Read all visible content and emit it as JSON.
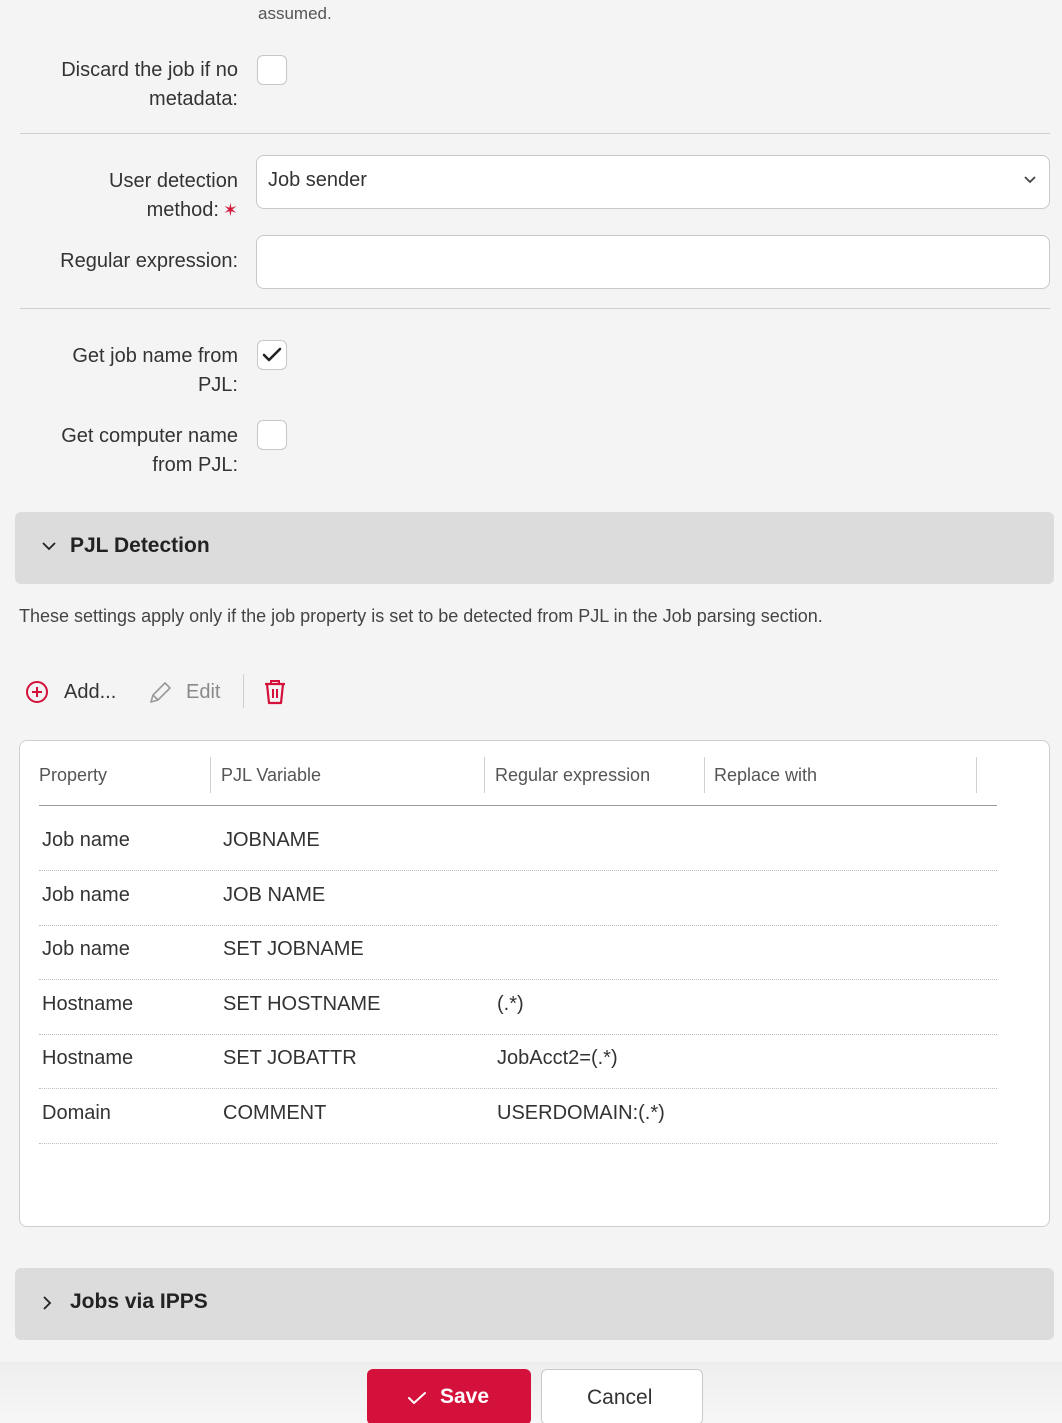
{
  "top": {
    "truncated_text": "assumed."
  },
  "form": {
    "discard_label_1": "Discard the job if no",
    "discard_label_2": "metadata:",
    "discard_checked": false,
    "user_detection_label_1": "User detection",
    "user_detection_label_2": "method:",
    "required_mark": "✶",
    "user_detection_value": "Job sender",
    "regex_label": "Regular expression:",
    "regex_value": "",
    "job_name_label_1": "Get job name from",
    "job_name_label_2": "PJL:",
    "job_name_checked": true,
    "computer_name_label_1": "Get computer name",
    "computer_name_label_2": "from PJL:",
    "computer_name_checked": false
  },
  "pjl_section": {
    "title": "PJL Detection",
    "expanded": true,
    "info": "These settings apply only if the job property is set to be detected from PJL in the Job parsing section.",
    "toolbar": {
      "add_label": "Add...",
      "edit_label": "Edit"
    },
    "table": {
      "headers": [
        "Property",
        "PJL Variable",
        "Regular expression",
        "Replace with"
      ],
      "rows": [
        {
          "property": "Job name",
          "variable": "JOBNAME",
          "regex": "",
          "replace": ""
        },
        {
          "property": "Job name",
          "variable": "JOB NAME",
          "regex": "",
          "replace": ""
        },
        {
          "property": "Job name",
          "variable": "SET JOBNAME",
          "regex": "",
          "replace": ""
        },
        {
          "property": "Hostname",
          "variable": "SET HOSTNAME",
          "regex": "(.*)",
          "replace": ""
        },
        {
          "property": "Hostname",
          "variable": "SET JOBATTR",
          "regex": "JobAcct2=(.*)",
          "replace": ""
        },
        {
          "property": "Domain",
          "variable": "COMMENT",
          "regex": "USERDOMAIN:(.*)",
          "replace": ""
        }
      ]
    }
  },
  "ipps_section": {
    "title": "Jobs via IPPS",
    "expanded": false
  },
  "footer": {
    "save_label": "Save",
    "cancel_label": "Cancel"
  },
  "colors": {
    "accent": "#d3113a",
    "section_bg": "#dcdcdc",
    "page_bg": "#f4f4f4"
  }
}
